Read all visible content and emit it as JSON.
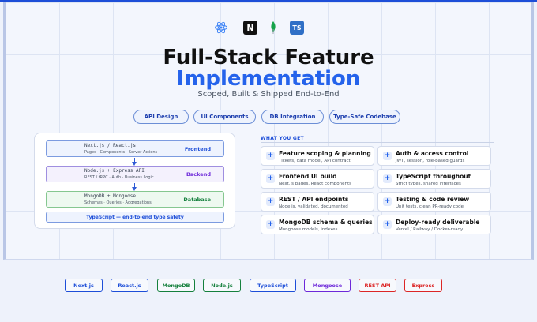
{
  "logos": {
    "items": [
      {
        "name": "react-logo-icon",
        "color": "#3b82f6"
      },
      {
        "name": "nextjs-logo-icon",
        "text": "N",
        "color": "#111111"
      },
      {
        "name": "mongodb-leaf-icon",
        "color": "#16a34a"
      },
      {
        "name": "typescript-logo-icon",
        "text": "TS",
        "color": "#2f6fc6"
      }
    ]
  },
  "hero": {
    "title_line1": "Full-Stack Feature",
    "title_line2": "Implementation",
    "subtitle": "Scoped, Built & Shipped End-to-End",
    "accent_color": "#2563eb"
  },
  "pills": [
    "API Design",
    "UI Components",
    "DB Integration",
    "Type-Safe Codebase"
  ],
  "architecture": {
    "layers": [
      {
        "tech": "Next.js / React.js",
        "details": "Pages · Components · Server Actions",
        "label": "Frontend",
        "color": "#1d4ed8"
      },
      {
        "tech": "Node.js + Express API",
        "details": "REST / tRPC · Auth · Business Logic",
        "label": "Backend",
        "color": "#6d28d9"
      },
      {
        "tech": "MongoDB + Mongoose",
        "details": "Schemas · Queries · Aggregations",
        "label": "Database",
        "color": "#15803d"
      }
    ],
    "typescript_bar": "TypeScript — end-to-end type safety"
  },
  "what_you_get": {
    "heading": "WHAT YOU GET",
    "items": [
      {
        "title": "Feature scoping & planning",
        "subtitle": "Tickets, data model, API contract"
      },
      {
        "title": "Auth & access control",
        "subtitle": "JWT, session, role-based guards"
      },
      {
        "title": "Frontend UI build",
        "subtitle": "Next.js pages, React components"
      },
      {
        "title": "TypeScript throughout",
        "subtitle": "Strict types, shared interfaces"
      },
      {
        "title": "REST / API endpoints",
        "subtitle": "Node.js, validated, documented"
      },
      {
        "title": "Testing & code review",
        "subtitle": "Unit tests, clean PR-ready code"
      },
      {
        "title": "MongoDB schema & queries",
        "subtitle": "Mongoose models, indexes"
      },
      {
        "title": "Deploy-ready deliverable",
        "subtitle": "Vercel / Railway / Docker-ready"
      }
    ]
  },
  "tech_tags": [
    {
      "label": "Next.js",
      "color": "#1d4ed8"
    },
    {
      "label": "React.js",
      "color": "#1d4ed8"
    },
    {
      "label": "MongoDB",
      "color": "#15803d"
    },
    {
      "label": "Node.js",
      "color": "#15803d"
    },
    {
      "label": "TypeScript",
      "color": "#1d4ed8"
    },
    {
      "label": "Mongoose",
      "color": "#6d28d9"
    },
    {
      "label": "REST API",
      "color": "#dc2626"
    },
    {
      "label": "Express",
      "color": "#dc2626"
    }
  ]
}
